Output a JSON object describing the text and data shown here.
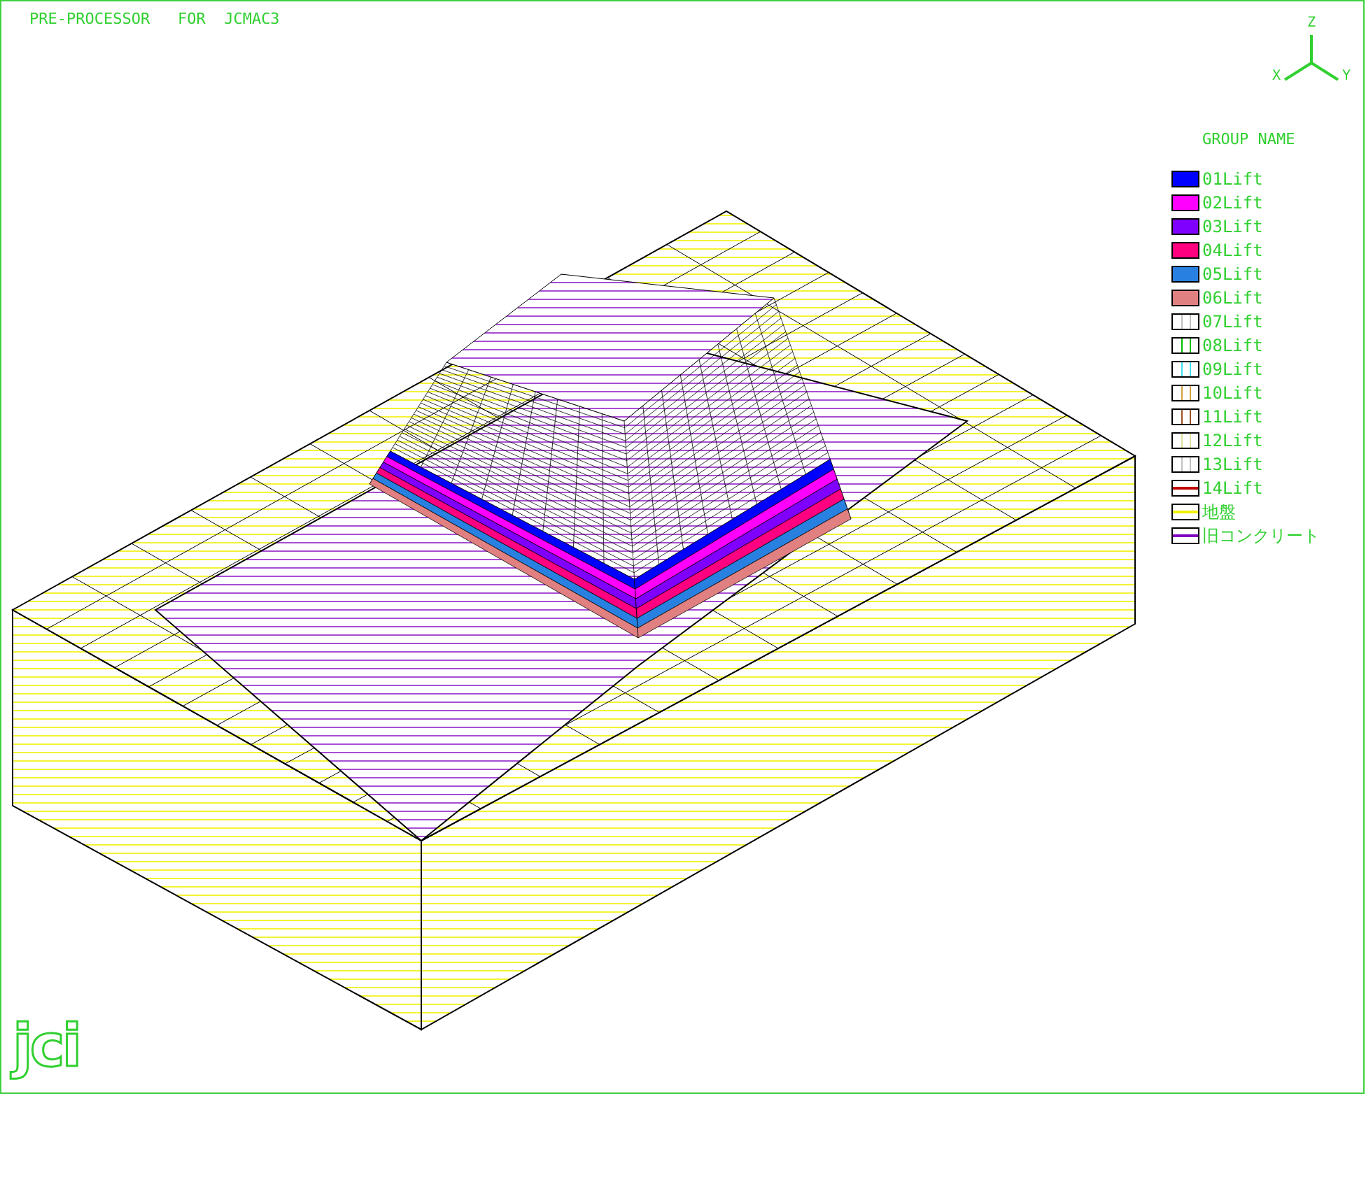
{
  "window": {
    "title": "PRE-PROCESSOR   FOR  JCMAC3"
  },
  "axes": {
    "z": "Z",
    "x": "X",
    "y": "Y"
  },
  "legend": {
    "title": "GROUP NAME",
    "items": [
      {
        "label": "01Lift",
        "kind": "solid",
        "color": "#0000ff"
      },
      {
        "label": "02Lift",
        "kind": "solid",
        "color": "#ff00ff"
      },
      {
        "label": "03Lift",
        "kind": "solid",
        "color": "#8000ff"
      },
      {
        "label": "04Lift",
        "kind": "solid",
        "color": "#ff0080"
      },
      {
        "label": "05Lift",
        "kind": "solid",
        "color": "#2880e0"
      },
      {
        "label": "06Lift",
        "kind": "solid",
        "color": "#e08080"
      },
      {
        "label": "07Lift",
        "kind": "vlines",
        "color": "#c0c0c0"
      },
      {
        "label": "08Lift",
        "kind": "vlines",
        "color": "#00c000"
      },
      {
        "label": "09Lift",
        "kind": "vlines",
        "color": "#40e0f0"
      },
      {
        "label": "10Lift",
        "kind": "vlines",
        "color": "#d0a040"
      },
      {
        "label": "11Lift",
        "kind": "vlines",
        "color": "#a05020"
      },
      {
        "label": "12Lift",
        "kind": "vlines",
        "color": "#e0e0a0"
      },
      {
        "label": "13Lift",
        "kind": "vlines",
        "color": "#c0c0c0"
      },
      {
        "label": "14Lift",
        "kind": "hline",
        "color": "#c00000"
      },
      {
        "label": "地盤",
        "kind": "hline",
        "color": "#f0f000"
      },
      {
        "label": "旧コンクリート",
        "kind": "hline",
        "color": "#8000c0"
      }
    ]
  },
  "logo": "jci"
}
